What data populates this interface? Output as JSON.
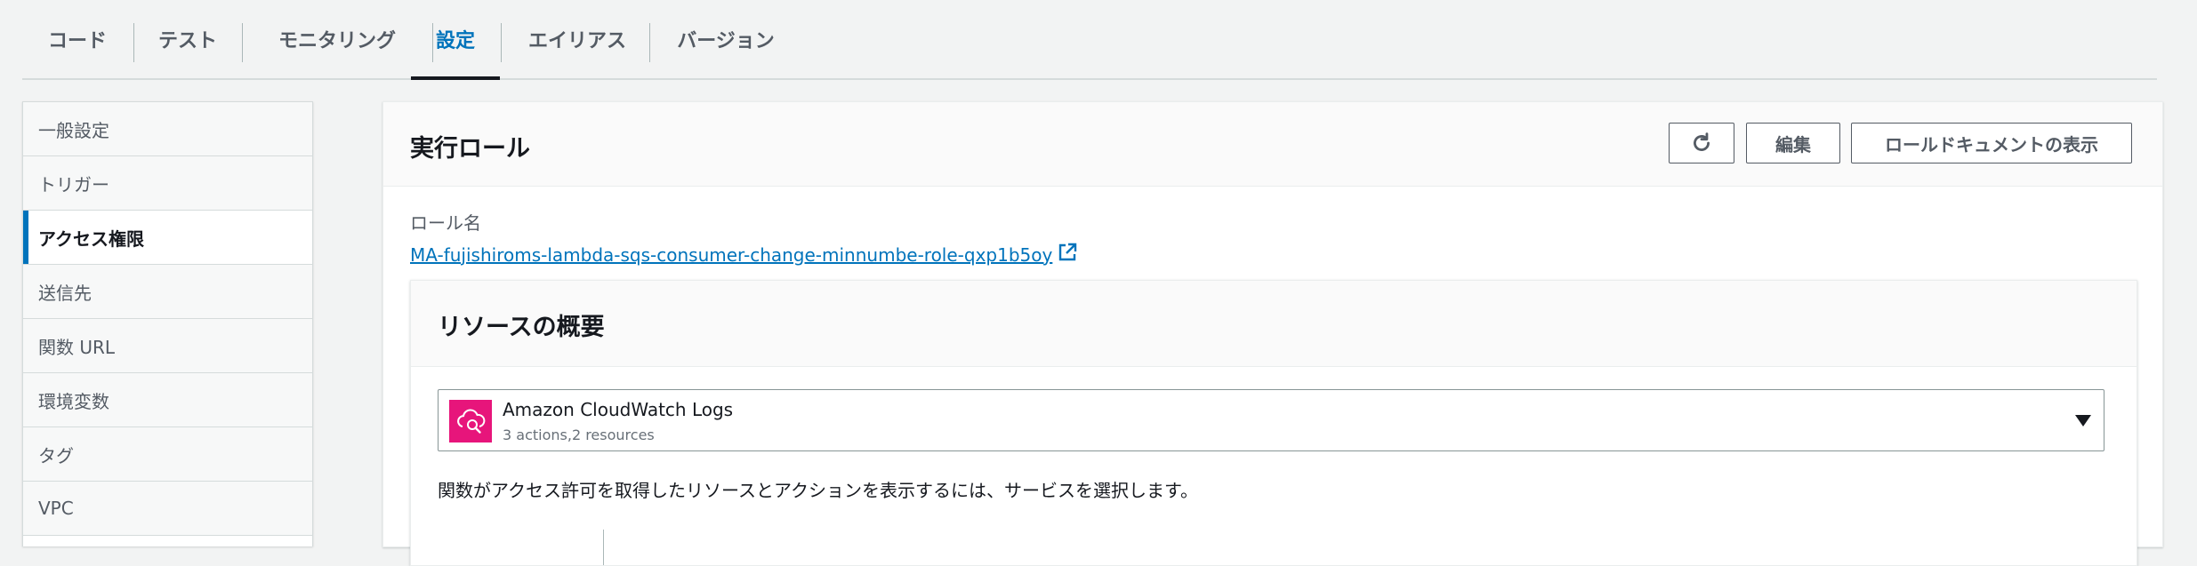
{
  "tabs": [
    {
      "label": "コード"
    },
    {
      "label": "テスト"
    },
    {
      "label": "モニタリング"
    },
    {
      "label": "設定",
      "active": true
    },
    {
      "label": "エイリアス"
    },
    {
      "label": "バージョン"
    }
  ],
  "sidenav": {
    "items": [
      {
        "label": "一般設定"
      },
      {
        "label": "トリガー"
      },
      {
        "label": "アクセス権限",
        "active": true
      },
      {
        "label": "送信先"
      },
      {
        "label": "関数 URL"
      },
      {
        "label": "環境変数"
      },
      {
        "label": "タグ"
      },
      {
        "label": "VPC"
      }
    ]
  },
  "execution_role": {
    "title": "実行ロール",
    "refresh_icon": "refresh-icon",
    "edit_label": "編集",
    "view_doc_label": "ロールドキュメントの表示",
    "role_name_label": "ロール名",
    "role_name": "MA-fujishiroms-lambda-sqs-consumer-change-minnumbe-role-qxp1b5oy",
    "external_link_icon": "external-link-icon"
  },
  "resource_summary": {
    "title": "リソースの概要",
    "selected_service": "Amazon CloudWatch Logs",
    "selected_service_detail": "3 actions,2 resources",
    "help_text": "関数がアクセス許可を取得したリソースとアクションを表示するには、サービスを選択します。"
  },
  "colors": {
    "accent": "#0073bb",
    "cloudwatch_icon": "#e7157b",
    "background": "#f2f3f3"
  }
}
